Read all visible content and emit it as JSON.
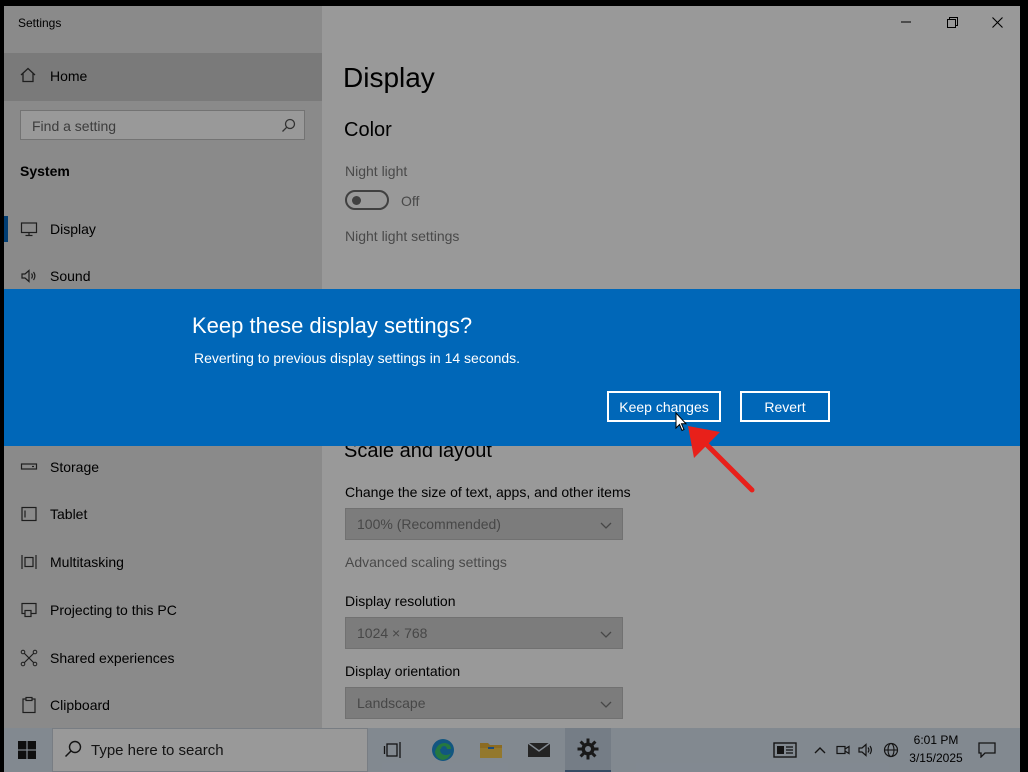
{
  "window": {
    "title": "Settings"
  },
  "sidebar": {
    "home": "Home",
    "search_placeholder": "Find a setting",
    "section": "System",
    "items": [
      {
        "label": "Display",
        "icon": "monitor-icon"
      },
      {
        "label": "Sound",
        "icon": "speaker-icon"
      },
      {
        "label": "Storage",
        "icon": "storage-icon"
      },
      {
        "label": "Tablet",
        "icon": "tablet-icon"
      },
      {
        "label": "Multitasking",
        "icon": "multitasking-icon"
      },
      {
        "label": "Projecting to this PC",
        "icon": "projecting-icon"
      },
      {
        "label": "Shared experiences",
        "icon": "shared-icon"
      },
      {
        "label": "Clipboard",
        "icon": "clipboard-icon"
      }
    ]
  },
  "main": {
    "title": "Display",
    "color_heading": "Color",
    "night_light_label": "Night light",
    "night_light_state": "Off",
    "night_light_settings_link": "Night light settings",
    "scale_heading": "Scale and layout",
    "scale_label": "Change the size of text, apps, and other items",
    "scale_value": "100% (Recommended)",
    "advanced_scaling_link": "Advanced scaling settings",
    "resolution_label": "Display resolution",
    "resolution_value": "1024 × 768",
    "orientation_label": "Display orientation",
    "orientation_value": "Landscape"
  },
  "dialog": {
    "title": "Keep these display settings?",
    "message": "Reverting to previous display settings in 14 seconds.",
    "keep_label": "Keep changes",
    "revert_label": "Revert"
  },
  "taskbar": {
    "search_placeholder": "Type here to search",
    "time": "6:01 PM",
    "date": "3/15/2025"
  },
  "colors": {
    "dialog_bg": "#0067b8",
    "accent": "#0067c0",
    "annotation_arrow": "#e8201a"
  }
}
